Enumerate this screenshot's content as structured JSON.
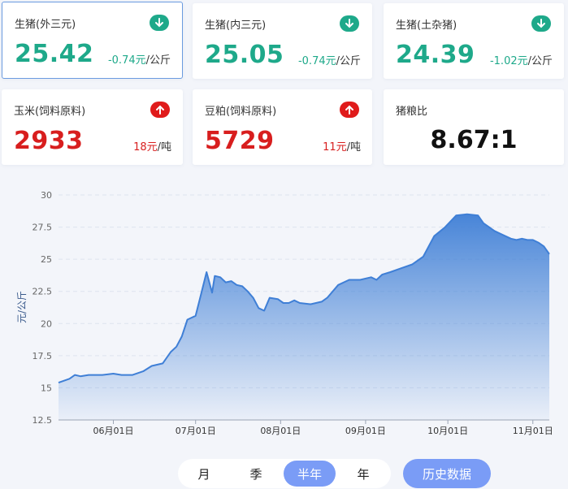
{
  "cards": [
    {
      "name": "生猪(外三元)",
      "price": "25.42",
      "change": "-0.74元",
      "unit": "/公斤",
      "trend": "down"
    },
    {
      "name": "生猪(内三元)",
      "price": "25.05",
      "change": "-0.74元",
      "unit": "/公斤",
      "trend": "down"
    },
    {
      "name": "生猪(土杂猪)",
      "price": "24.39",
      "change": "-1.02元",
      "unit": "/公斤",
      "trend": "down"
    },
    {
      "name": "玉米(饲料原料)",
      "price": "2933",
      "change": "18元",
      "unit": "/吨",
      "trend": "up"
    },
    {
      "name": "豆粕(饲料原料)",
      "price": "5729",
      "change": "11元",
      "unit": "/吨",
      "trend": "up"
    },
    {
      "name": "猪粮比",
      "ratio": "8.67:1"
    }
  ],
  "icons": {
    "down": "arrow-down-circle-icon",
    "up": "arrow-up-circle-icon"
  },
  "colors": {
    "down": "#1ea98a",
    "up": "#e01b1b",
    "line": "#3f7fd6",
    "accent": "#7a9cf6"
  },
  "chart_data": {
    "type": "area",
    "title": "",
    "xlabel": "",
    "ylabel": "元/公斤",
    "ylim": [
      12.5,
      30
    ],
    "yticks": [
      "12.5",
      "15",
      "17.5",
      "20",
      "22.5",
      "25",
      "27.5",
      "30"
    ],
    "xticks": [
      "06月01日",
      "07月01日",
      "08月01日",
      "09月01日",
      "10月01日",
      "11月01日"
    ],
    "grid": true,
    "series": [
      {
        "x": [
          "2021-05-12",
          "2021-05-16",
          "2021-05-18",
          "2021-05-20",
          "2021-05-23",
          "2021-05-25",
          "2021-05-28",
          "2021-06-01",
          "2021-06-04",
          "2021-06-08",
          "2021-06-12",
          "2021-06-15",
          "2021-06-19",
          "2021-06-22",
          "2021-06-24",
          "2021-06-26",
          "2021-06-28",
          "2021-07-01",
          "2021-07-03",
          "2021-07-05",
          "2021-07-07",
          "2021-07-08",
          "2021-07-10",
          "2021-07-12",
          "2021-07-14",
          "2021-07-16",
          "2021-07-18",
          "2021-07-20",
          "2021-07-22",
          "2021-07-24",
          "2021-07-26",
          "2021-07-28",
          "2021-07-31",
          "2021-08-02",
          "2021-08-04",
          "2021-08-06",
          "2021-08-08",
          "2021-08-12",
          "2021-08-16",
          "2021-08-18",
          "2021-08-22",
          "2021-08-26",
          "2021-08-30",
          "2021-09-03",
          "2021-09-05",
          "2021-09-07",
          "2021-09-10",
          "2021-09-14",
          "2021-09-18",
          "2021-09-22",
          "2021-09-26",
          "2021-09-30",
          "2021-10-04",
          "2021-10-08",
          "2021-10-12",
          "2021-10-14",
          "2021-10-16",
          "2021-10-18",
          "2021-10-20",
          "2021-10-22",
          "2021-10-24",
          "2021-10-26",
          "2021-10-28",
          "2021-10-30",
          "2021-11-01",
          "2021-11-03",
          "2021-11-05",
          "2021-11-07"
        ],
        "values": [
          15.4,
          15.7,
          16.0,
          15.9,
          16.0,
          16.0,
          16.0,
          16.1,
          16.0,
          16.0,
          16.3,
          16.7,
          16.9,
          17.8,
          18.2,
          19.0,
          20.3,
          20.6,
          22.3,
          24.0,
          22.4,
          23.7,
          23.6,
          23.2,
          23.3,
          23.0,
          22.9,
          22.5,
          22.0,
          21.2,
          21.0,
          22.0,
          21.9,
          21.6,
          21.6,
          21.8,
          21.6,
          21.5,
          21.7,
          22.0,
          23.0,
          23.4,
          23.4,
          23.6,
          23.4,
          23.8,
          24.0,
          24.3,
          24.6,
          25.2,
          26.8,
          27.5,
          28.4,
          28.5,
          28.4,
          27.8,
          27.5,
          27.2,
          27.0,
          26.8,
          26.6,
          26.5,
          26.6,
          26.5,
          26.5,
          26.3,
          26.0,
          25.4
        ]
      }
    ]
  },
  "controls": {
    "ranges": [
      {
        "label": "月"
      },
      {
        "label": "季"
      },
      {
        "label": "半年",
        "selected": true
      },
      {
        "label": "年"
      }
    ],
    "history_button": "历史数据"
  }
}
